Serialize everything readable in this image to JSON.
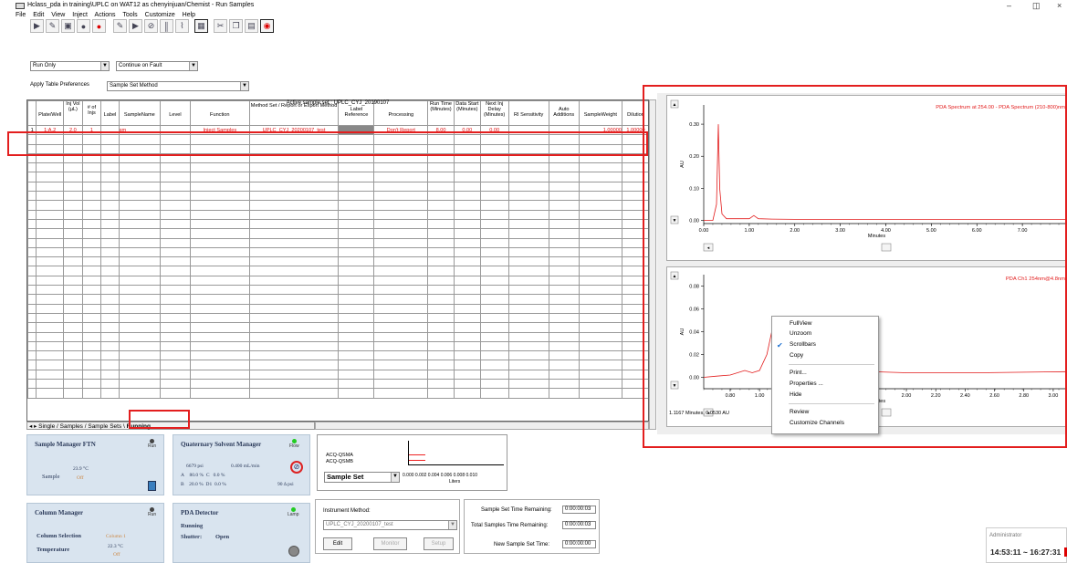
{
  "window": {
    "title": "Hclass_pda in training\\UPLC on WAT12 as chenyinjuan/Chemist - Run Samples",
    "minimize": "–",
    "maximize": "◫",
    "close": "×"
  },
  "menu": [
    "File",
    "Edit",
    "View",
    "Inject",
    "Actions",
    "Tools",
    "Customize",
    "Help"
  ],
  "run_mode": {
    "value": "Run Only"
  },
  "fault_mode": {
    "value": "Continue on Fault"
  },
  "table_prefs": {
    "label": "Apply Table Preferences",
    "value": "Sample Set Method"
  },
  "active_sample_set": "Active sample set : UPLC_CYJ_20190107",
  "columns": [
    "",
    "Plate/Well",
    "Inj Vol (µL)",
    "# of Injs",
    "Label",
    "SampleName",
    "Level",
    "Function",
    "Method Set / Report or Export Method",
    "Label Reference",
    "Processing",
    "Run Time (Minutes)",
    "Data Start (Minutes)",
    "Next Inj Delay (Minutes)",
    "RI Sensitivity",
    "Auto Additions",
    "SampleWeight",
    "Dilution"
  ],
  "rows": [
    [
      "1",
      "1:A,2",
      "2.0",
      "1",
      "",
      "sm",
      "",
      "Inject Samples",
      "UPLC_CYJ_20200107_test",
      "",
      "Don't Report",
      "8.00",
      "0.00",
      "0.00",
      "",
      "",
      "1.00000",
      "1.00000"
    ]
  ],
  "tabs": [
    "Single",
    "Samples",
    "Sample Sets",
    "Running"
  ],
  "chart_top": {
    "title": "PDA Spectrum at 254.00 - PDA Spectrum (210-800)nm",
    "y_label": "AU",
    "x_label": "Minutes",
    "y_ticks": [
      "0.00",
      "0.10",
      "0.20",
      "0.30"
    ],
    "x_ticks": [
      "0.00",
      "1.00",
      "2.00",
      "3.00",
      "4.00",
      "5.00",
      "6.00",
      "7.00"
    ]
  },
  "chart_bottom": {
    "title": "PDA Ch1 254nm@4.8nm",
    "y_label": "AU",
    "x_label": "Minutes",
    "y_ticks": [
      "0.00",
      "0.02",
      "0.04",
      "0.06",
      "0.08"
    ],
    "x_ticks": [
      "0.80",
      "1.00",
      "2.00",
      "2.20",
      "2.40",
      "2.60",
      "2.80",
      "3.00"
    ],
    "cursor": "1.1167 Minutes, 0.0530 AU"
  },
  "chart_data": [
    {
      "type": "line",
      "title": "PDA Spectrum at 254.00 - PDA Spectrum (210-800)nm",
      "xlabel": "Minutes",
      "ylabel": "AU",
      "xlim": [
        0,
        8
      ],
      "ylim": [
        -0.01,
        0.36
      ],
      "x": [
        0,
        0.2,
        0.28,
        0.32,
        0.35,
        0.4,
        0.5,
        1.0,
        1.1,
        1.2,
        1.5,
        2.0,
        3.0,
        4.0,
        5.0,
        6.0,
        7.0,
        8.0
      ],
      "y": [
        0.0,
        0.0,
        0.05,
        0.3,
        0.1,
        0.02,
        0.005,
        0.005,
        0.015,
        0.005,
        0.004,
        0.003,
        0.003,
        0.003,
        0.003,
        0.003,
        0.003,
        0.003
      ]
    },
    {
      "type": "line",
      "title": "PDA Ch1 254nm@4.8nm",
      "xlabel": "Minutes",
      "ylabel": "AU",
      "xlim": [
        0.62,
        3.1
      ],
      "ylim": [
        -0.01,
        0.09
      ],
      "x": [
        0.62,
        0.7,
        0.8,
        0.9,
        0.95,
        1.0,
        1.05,
        1.1,
        1.117,
        1.15,
        1.2,
        1.3,
        1.5,
        2.0,
        2.5,
        3.1
      ],
      "y": [
        0.0,
        0.001,
        0.002,
        0.006,
        0.004,
        0.006,
        0.02,
        0.05,
        0.053,
        0.03,
        0.012,
        0.01,
        0.006,
        0.004,
        0.004,
        0.005
      ]
    }
  ],
  "context_menu": [
    "FullView",
    "Unzoom",
    "Scrollbars",
    "Copy",
    "Print...",
    "Properties ...",
    "Hide",
    "Review",
    "Customize Channels"
  ],
  "sample_manager": {
    "title": "Sample Manager FTN",
    "status": "Run",
    "sample_label": "Sample",
    "temp": "23.9",
    "temp_unit": "°C",
    "off": "Off"
  },
  "qsm": {
    "title": "Quaternary Solvent Manager",
    "status": "Flow",
    "pressure": "6679",
    "pressure_unit": "psi",
    "flow": "0.400 mL/min",
    "A": "A",
    "A_pct": "80.0 %",
    "C": "C",
    "C_pct": "0.0 %",
    "B": "B",
    "B_pct": "20.0 %",
    "D": "D1",
    "D_pct": "0.0 %",
    "delta": "90 Δ psi"
  },
  "solvent": {
    "line1": "ACQ-QSMA",
    "line2": "ACQ-QSMB",
    "select": "Sample Set",
    "axis": "0.000  0.002  0.004  0.006  0.008  0.010",
    "axis_label": "Liters"
  },
  "column_manager": {
    "title": "Column Manager",
    "status": "Run",
    "selection_label": "Column Selection",
    "selection": "Column 1",
    "temp_label": "Temperature",
    "temp": "22.3",
    "temp_unit": "°C",
    "off": "Off"
  },
  "pda": {
    "title": "PDA Detector",
    "status": "Lamp",
    "running": "Running",
    "shutter_label": "Shutter:",
    "shutter": "Open"
  },
  "instrument": {
    "label": "Instrument Method:",
    "value": "UPLC_CYJ_20200107_test",
    "edit": "Edit",
    "monitor": "Monitor",
    "setup": "Setup"
  },
  "times": {
    "set_remaining_label": "Sample Set Time Remaining:",
    "set_remaining": "0:00:00:03",
    "total_remaining_label": "Total Samples Time Remaining:",
    "total_remaining": "0:00:00:03",
    "new_time_label": "New Sample Set Time:",
    "new_time": "0:00:00:00"
  },
  "clock": {
    "user": "Administrator",
    "time": "14:53:11 ~ 16:27:31"
  }
}
